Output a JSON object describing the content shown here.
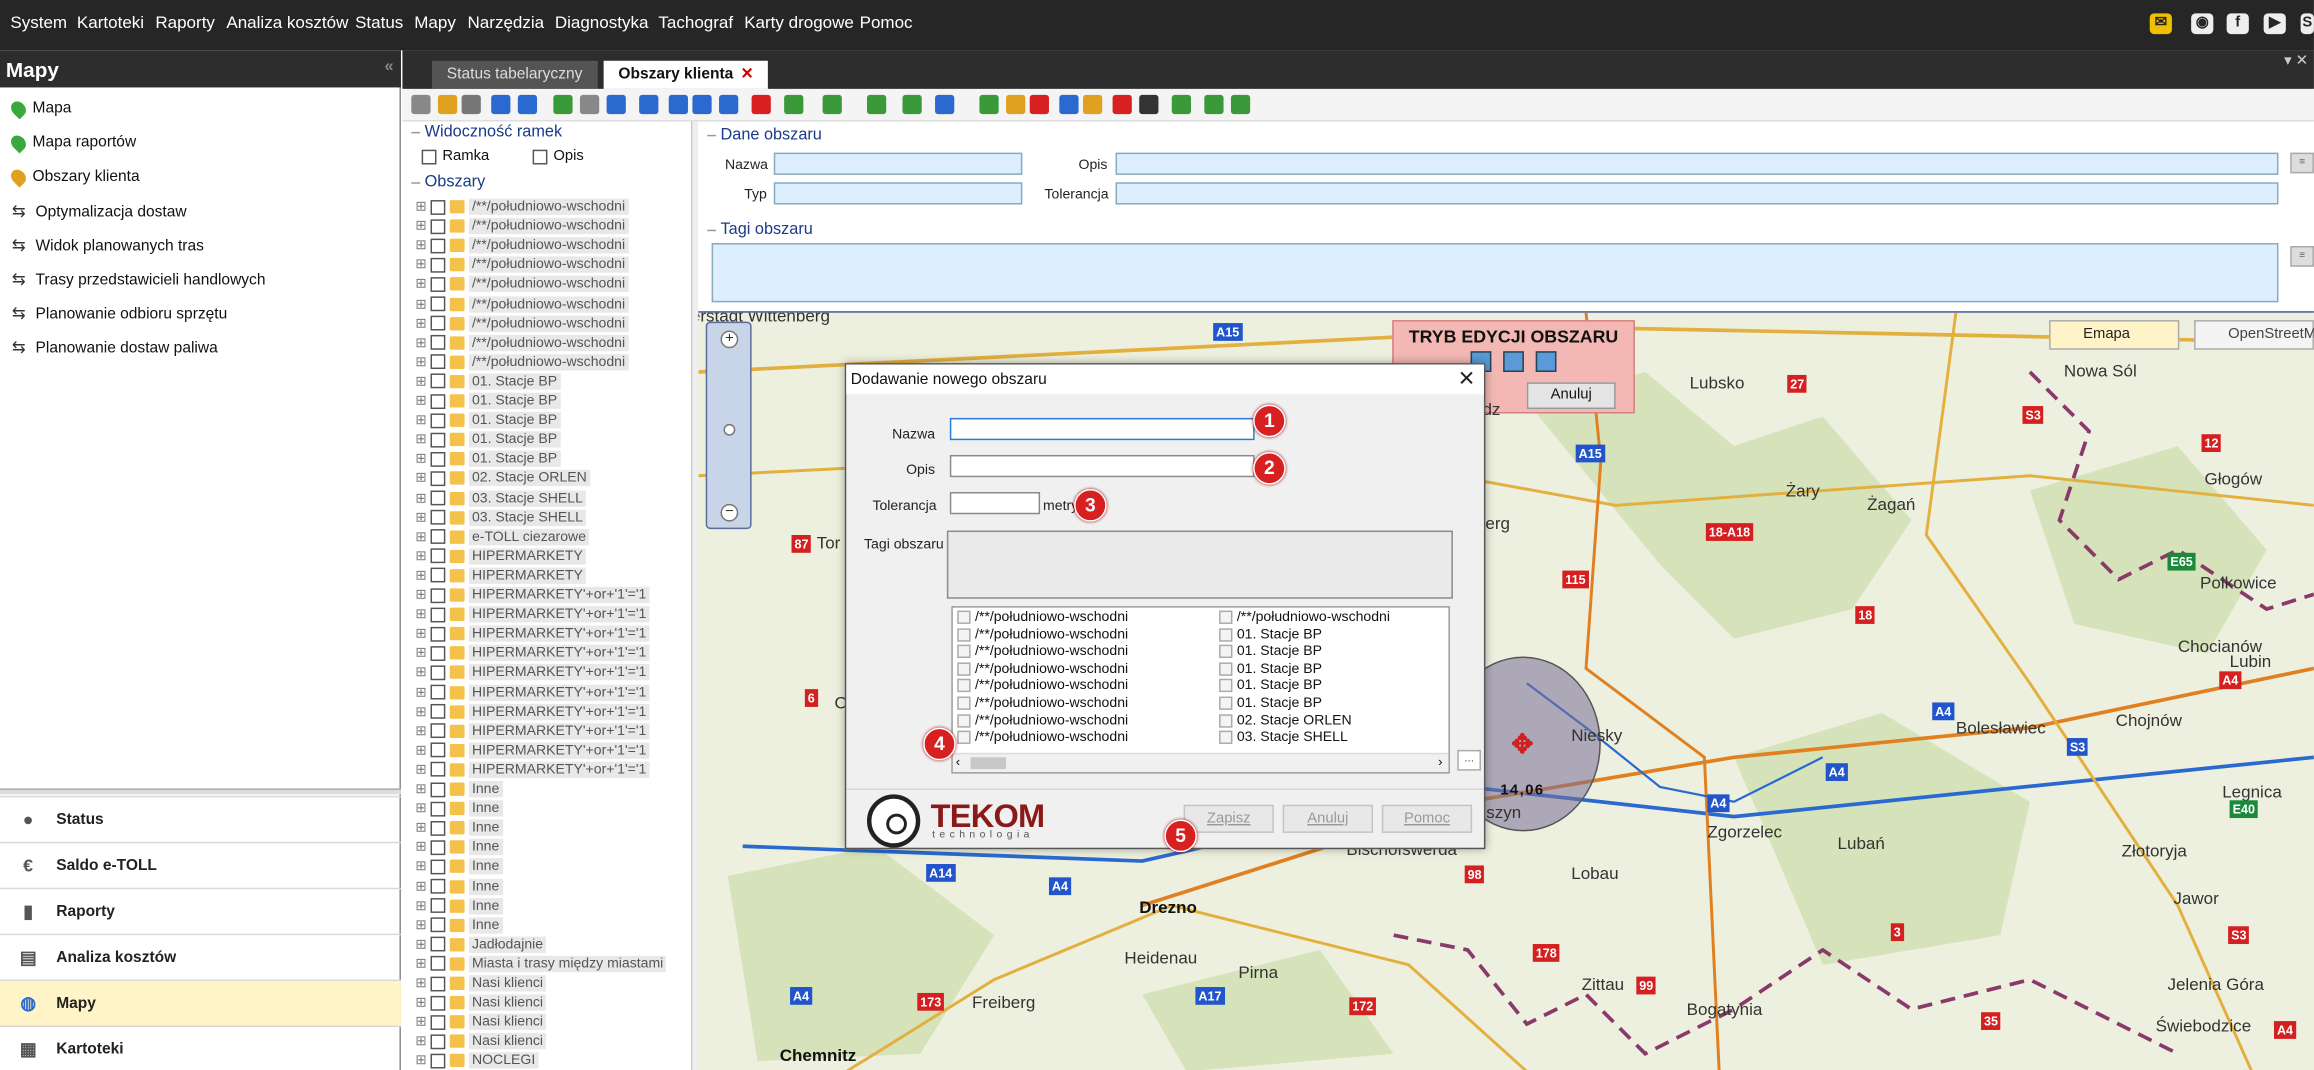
{
  "menu": [
    "System",
    "Kartoteki",
    "Raporty",
    "Analiza kosztów",
    "Status",
    "Mapy",
    "Narzędzia",
    "Diagnostyka",
    "Tachograf",
    "Karty drogowe",
    "Pomoc"
  ],
  "left_panel": {
    "title": "Mapy",
    "items": [
      "Mapa",
      "Mapa raportów",
      "Obszary klienta",
      "Optymalizacja dostaw",
      "Widok planowanych tras",
      "Trasy przedstawicieli handlowych",
      "Planowanie odbioru sprzętu",
      "Planowanie dostaw paliwa"
    ],
    "nav": [
      "Status",
      "Saldo e-TOLL",
      "Raporty",
      "Analiza kosztów",
      "Mapy",
      "Kartoteki"
    ],
    "active_nav": "Mapy"
  },
  "tabs": {
    "inactive": "Status tabelaryczny",
    "active": "Obszary klienta",
    "close": "✕"
  },
  "tree": {
    "visibility_title": "Widoczność ramek",
    "frame_label": "Ramka",
    "desc_label": "Opis",
    "areas_title": "Obszary",
    "nodes": [
      "/**/południowo-wschodni",
      "/**/południowo-wschodni",
      "/**/południowo-wschodni",
      "/**/południowo-wschodni",
      "/**/południowo-wschodni",
      "/**/południowo-wschodni",
      "/**/południowo-wschodni",
      "/**/południowo-wschodni",
      "/**/południowo-wschodni",
      "01. Stacje BP",
      "01. Stacje BP",
      "01. Stacje BP",
      "01. Stacje BP",
      "01. Stacje BP",
      "02. Stacje ORLEN",
      "03. Stacje SHELL",
      "03. Stacje SHELL",
      "e-TOLL ciezarowe",
      "HIPERMARKETY",
      "HIPERMARKETY",
      "HIPERMARKETY'+or+'1'='1",
      "HIPERMARKETY'+or+'1'='1",
      "HIPERMARKETY'+or+'1'='1",
      "HIPERMARKETY'+or+'1'='1",
      "HIPERMARKETY'+or+'1'='1",
      "HIPERMARKETY'+or+'1'='1",
      "HIPERMARKETY'+or+'1'='1",
      "HIPERMARKETY'+or+'1'='1",
      "HIPERMARKETY'+or+'1'='1",
      "HIPERMARKETY'+or+'1'='1",
      "Inne",
      "Inne",
      "Inne",
      "Inne",
      "Inne",
      "Inne",
      "Inne",
      "Inne",
      "Jadłodajnie",
      "Miasta i trasy między miastami",
      "Nasi klienci",
      "Nasi klienci",
      "Nasi klienci",
      "Nasi klienci",
      "NOCLEGI"
    ]
  },
  "form": {
    "section_data": "Dane obszaru",
    "name_label": "Nazwa",
    "desc_label": "Opis",
    "type_label": "Typ",
    "tolerance_label": "Tolerancja",
    "section_tags": "Tagi obszaru"
  },
  "map": {
    "edit_mode_title": "TRYB EDYCJI OBSZARU",
    "cancel": "Anuluj",
    "provider_emapa": "Emapa",
    "provider_osm": "OpenStreetMap",
    "circle_label": "14,06",
    "places": [
      "erstadt Wittenberg",
      "Lubsko",
      "Nowa Sól",
      "Żary",
      "Żagań",
      "Głogów",
      "Polkowice",
      "Chocianów",
      "Lubin",
      "Niesky",
      "Bolesławiec",
      "Chojnów",
      "Legnica",
      "Zgorzelec",
      "Lubań",
      "Złotoryja",
      "Jawor",
      "Jelenia Góra",
      "Świebodzice",
      "Lobau",
      "Zittau",
      "Bogatynia",
      "Bischofswerda",
      "Drezno",
      "Heidenau",
      "Pirna",
      "Freiberg",
      "Chemnitz",
      "erg",
      "Tor",
      "O",
      "iszyn",
      "dz"
    ],
    "roads": [
      "A15",
      "A15",
      "27",
      "S3",
      "12",
      "18-A18",
      "115",
      "E65",
      "18",
      "87",
      "6",
      "A4",
      "A4",
      "S3",
      "A4",
      "A4",
      "E40",
      "A14",
      "A4",
      "98",
      "178",
      "99",
      "A17",
      "173",
      "172",
      "A4",
      "S3",
      "3",
      "35",
      "A4"
    ]
  },
  "dialog": {
    "title": "Dodawanie nowego obszaru",
    "name_label": "Nazwa",
    "desc_label": "Opis",
    "tolerance_label": "Tolerancja",
    "tolerance_unit": "metry",
    "tags_label": "Tagi obszaru",
    "list_left": [
      "/**/południowo-wschodni",
      "/**/południowo-wschodni",
      "/**/południowo-wschodni",
      "/**/południowo-wschodni",
      "/**/południowo-wschodni",
      "/**/południowo-wschodni",
      "/**/południowo-wschodni",
      "/**/południowo-wschodni"
    ],
    "list_right": [
      "/**/południowo-wschodni",
      "01. Stacje BP",
      "01. Stacje BP",
      "01. Stacje BP",
      "01. Stacje BP",
      "01. Stacje BP",
      "02. Stacje ORLEN",
      "03. Stacje SHELL"
    ],
    "more": "...",
    "save": "Zapisz",
    "cancel": "Anuluj",
    "help": "Pomoc",
    "numbers": [
      "1",
      "2",
      "3",
      "4",
      "5"
    ],
    "logo_name": "TEKOM",
    "logo_sub": "technologia"
  },
  "colors": {
    "accent_red": "#d82020",
    "field_blue": "#ddeeff",
    "header_dark": "#262626"
  }
}
